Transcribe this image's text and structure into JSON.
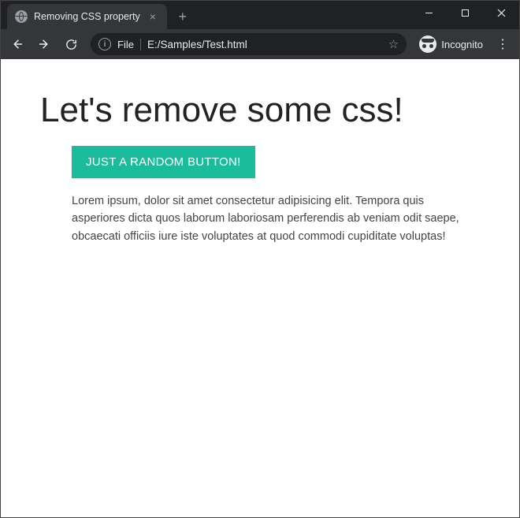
{
  "window": {
    "tab_title": "Removing CSS property"
  },
  "address_bar": {
    "scheme": "File",
    "url": "E:/Samples/Test.html",
    "incognito_label": "Incognito"
  },
  "page": {
    "heading": "Let's remove some css!",
    "button_label": "JUST A RANDOM BUTTON!",
    "paragraph": "Lorem ipsum, dolor sit amet consectetur adipisicing elit. Tempora quis asperiores dicta quos laborum laboriosam perferendis ab veniam odit saepe, obcaecati officiis iure iste voluptates at quod commodi cupiditate voluptas!"
  },
  "colors": {
    "button_bg": "#1abc9c",
    "chrome_dark": "#202124",
    "chrome_mid": "#35363a"
  }
}
